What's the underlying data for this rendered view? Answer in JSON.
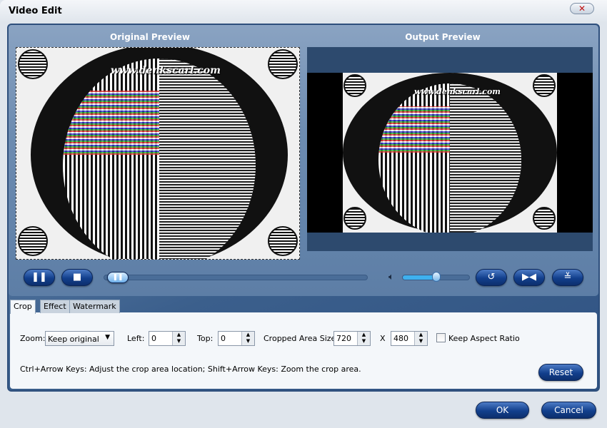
{
  "window": {
    "title": "Video Edit",
    "close_icon": "close-icon"
  },
  "preview": {
    "original_label": "Original Preview",
    "output_label": "Output Preview",
    "watermark": "www.denkscarl.com"
  },
  "player": {
    "progress_percent": 2,
    "volume_percent": 50
  },
  "tabs": [
    {
      "label": "Crop",
      "active": true
    },
    {
      "label": "Effect"
    },
    {
      "label": "Watermark"
    }
  ],
  "crop": {
    "zoom_label": "Zoom:",
    "zoom_value": "Keep original",
    "left_label": "Left:",
    "left_value": "0",
    "top_label": "Top:",
    "top_value": "0",
    "size_label": "Cropped Area Size:",
    "width_value": "720",
    "x_label": "X",
    "height_value": "480",
    "keep_aspect_label": "Keep Aspect Ratio",
    "keep_aspect_checked": false,
    "hint": "Ctrl+Arrow Keys: Adjust the crop area location; Shift+Arrow Keys: Zoom the crop area.",
    "reset_label": "Reset"
  },
  "footer": {
    "ok_label": "OK",
    "cancel_label": "Cancel"
  },
  "colors": {
    "accent": "#123f8c",
    "panel": "#3b5f8c"
  }
}
